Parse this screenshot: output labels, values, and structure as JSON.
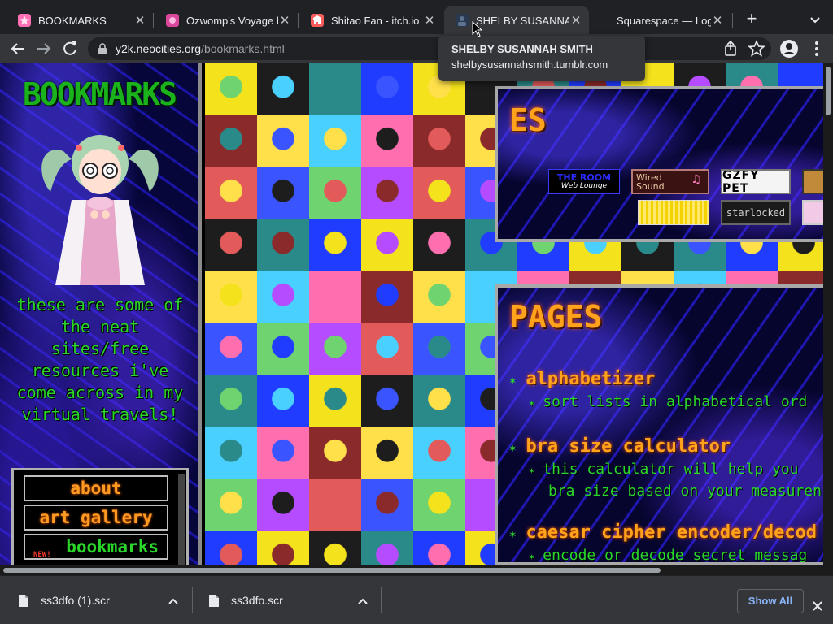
{
  "tabs": [
    {
      "title": "BOOKMARKS",
      "favicon": "pink-star-icon",
      "active": false
    },
    {
      "title": "Ozwomp's Voyage b",
      "favicon": "pink-square-icon",
      "active": false
    },
    {
      "title": "Shitao Fan - itch.io",
      "favicon": "itch-io-icon",
      "active": false
    },
    {
      "title": "SHELBY SUSANNAH",
      "favicon": "dark-avatar-icon",
      "active": true
    },
    {
      "title": "Squarespace — Log",
      "favicon": "none",
      "active": false
    }
  ],
  "tooltip": {
    "title": "SHELBY SUSANNAH SMITH",
    "url": "shelbysusannahsmith.tumblr.com"
  },
  "address_bar": {
    "host": "y2k.neocities.org",
    "path": "/bookmarks.html"
  },
  "page": {
    "title": "BOOKMARKS",
    "intro": "these are some of the neat sites/free resources i've come across in my virtual travels!",
    "nav": [
      {
        "label": "about"
      },
      {
        "label": "art gallery"
      },
      {
        "label": "bookmarks",
        "badge": "NEW!"
      }
    ],
    "sites_heading": "ES",
    "site_buttons": [
      {
        "brand": "THE ROOM",
        "sub": "Web Lounge"
      },
      {
        "text": "Wired Sound",
        "icon": "music-note-icon"
      },
      {
        "text": "GZFY PET"
      },
      {
        "text": "starlocked"
      }
    ],
    "pages_heading": "PAGES",
    "pages": [
      {
        "name": "alphabetizer",
        "desc": [
          "sort lists in alphabetical ord"
        ]
      },
      {
        "name": "bra size calculator",
        "desc": [
          "this calculator will help you",
          "bra size based on your measuren"
        ]
      },
      {
        "name": "caesar cipher encoder/decod",
        "desc": [
          "encode or decode secret messag"
        ]
      }
    ]
  },
  "downloads": [
    {
      "filename": "ss3dfo (1).scr"
    },
    {
      "filename": "ss3dfo.scr"
    }
  ],
  "downloads_show_all": "Show All",
  "colors": {
    "browser_bg": "#202124",
    "toolbar_bg": "#35363a",
    "neon_green": "#2ad62a",
    "neon_orange": "#ffa21c",
    "link_blue": "#8ab4f8"
  }
}
